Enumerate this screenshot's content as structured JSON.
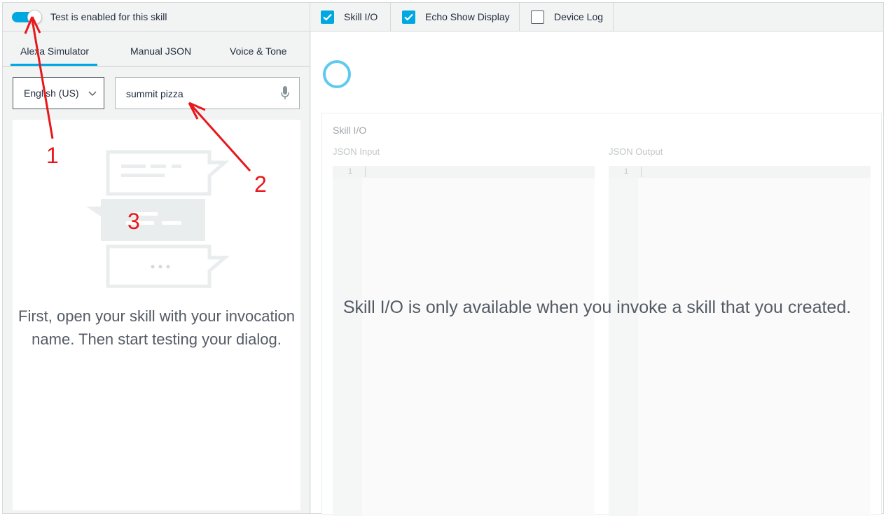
{
  "topbar": {
    "toggle_label": "Test is enabled for this skill",
    "toggle_on": true,
    "checkboxes": [
      {
        "label": "Skill I/O",
        "checked": true
      },
      {
        "label": "Echo Show Display",
        "checked": true
      },
      {
        "label": "Device Log",
        "checked": false
      }
    ]
  },
  "tabs": [
    {
      "label": "Alexa Simulator",
      "active": true
    },
    {
      "label": "Manual JSON",
      "active": false
    },
    {
      "label": "Voice & Tone",
      "active": false
    }
  ],
  "locale": {
    "selected": "English (US)"
  },
  "utterance": {
    "value": "summit pizza"
  },
  "chat": {
    "empty_message": "First, open your skill with your invocation name. Then start testing your dialog."
  },
  "skill_io": {
    "title": "Skill I/O",
    "json_input_label": "JSON Input",
    "json_output_label": "JSON Output",
    "line_number": "1",
    "unavailable_message": "Skill I/O is only available when you invoke a skill that you created."
  },
  "annotations": [
    "1",
    "2",
    "3"
  ],
  "colors": {
    "accent": "#00a8e1",
    "annotation": "#e8171c",
    "alexa_ring": "#5fcaf0",
    "background": "#f2f3f3"
  }
}
